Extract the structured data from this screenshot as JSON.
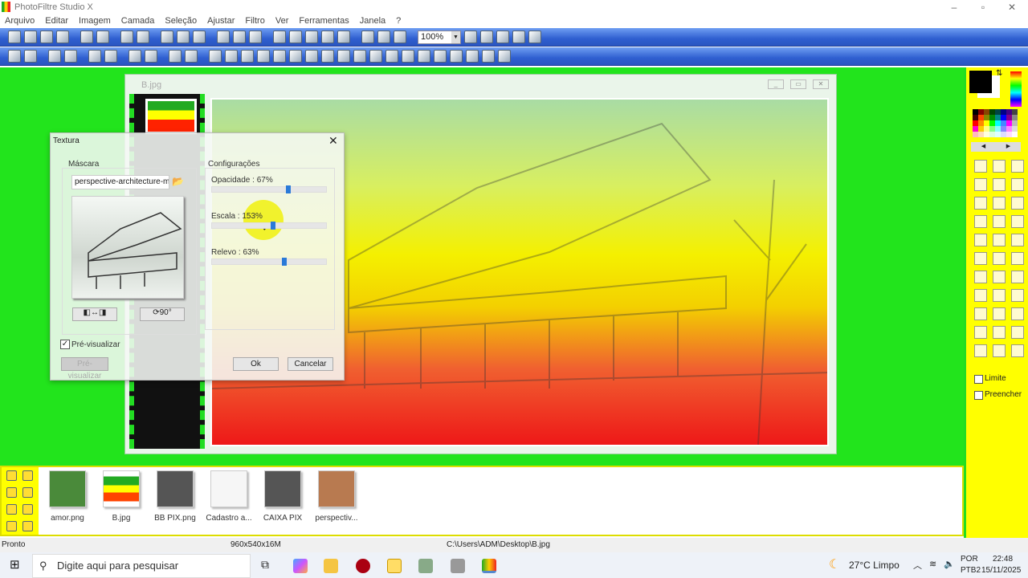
{
  "app": {
    "title": "PhotoFiltre Studio X"
  },
  "menu": [
    "Arquivo",
    "Editar",
    "Imagem",
    "Camada",
    "Seleção",
    "Ajustar",
    "Filtro",
    "Ver",
    "Ferramentas",
    "Janela",
    "?"
  ],
  "toolbar1": {
    "icons": [
      "new-file-icon",
      "open-icon",
      "save-icon",
      "scan-icon",
      "print-icon",
      "print-preview-icon",
      "undo-icon",
      "redo-icon",
      "paste-new-icon",
      "copy-icon",
      "paste-icon",
      "grayscale-icon",
      "rgb-icon",
      "transparency-icon",
      "flip-icon",
      "mirror-icon",
      "crop-icon",
      "text-icon",
      "resize-icon",
      "layer-icon",
      "effect-icon",
      "calendar-icon"
    ],
    "zoom_value": "100%",
    "zoom_icons": [
      "zoom-in-icon",
      "zoom-out-icon",
      "fit-window-icon",
      "actual-size-icon",
      "fullscreen-icon"
    ]
  },
  "toolbar2": {
    "icons": [
      "brightness-minus-icon",
      "brightness-plus-icon",
      "contrast-minus-icon",
      "contrast-plus-icon",
      "gamma-minus-icon",
      "gamma-plus-icon",
      "saturation-minus-icon",
      "saturation-plus-icon",
      "levels-icon",
      "histogram-icon",
      "invert-icon",
      "auto-levels-icon",
      "auto-contrast-icon",
      "film-icon",
      "film2-icon",
      "film3-icon",
      "blur-icon",
      "drop-icon",
      "drop2-icon",
      "mountain-icon",
      "sharpen-icon",
      "sharpen2-icon",
      "color-icon",
      "gradient-icon",
      "texture-icon",
      "columns-icon",
      "rows-icon",
      "layers-icon",
      "layers2-icon"
    ]
  },
  "document": {
    "title": "B.jpg"
  },
  "dialog": {
    "title": "Textura",
    "mask_label": "Máscara",
    "mask_file": "perspective-architecture-m",
    "settings_label": "Configurações",
    "sliders": [
      {
        "label": "Opacidade : 67%",
        "value": 67
      },
      {
        "label": "Escala : 153%",
        "value": 53
      },
      {
        "label": "Relevo : 63%",
        "value": 63
      }
    ],
    "preview_checkbox": "Pré-visualizar",
    "preview_checked": true,
    "preview_button": "Pré-visualizar",
    "ok": "Ok",
    "cancel": "Cancelar"
  },
  "right_panel": {
    "limit": "Limite",
    "fill": "Preencher",
    "tools": [
      "pointer-icon",
      "selection-icon",
      "hand-icon",
      "eyedropper-icon",
      "magic-wand-icon",
      "line-icon",
      "fill-icon",
      "spray-icon",
      "eraser-icon",
      "brush-icon",
      "advanced-brush-icon",
      "stamp-icon",
      "blur-drop-icon",
      "smudge-icon",
      "clone-icon",
      "pattern-icon",
      "portrait-icon",
      "strawberry-icon",
      "rectangle-icon",
      "ellipse-icon",
      "rounded-rect-icon",
      "diamond-icon",
      "triangle-icon",
      "play-shape-icon",
      "lasso-icon",
      "polygon-icon",
      "open-shape-icon",
      "select-all-icon",
      "ratio-43-icon",
      "ratio-32-icon",
      "vertical-select-icon",
      "crop-handles-icon",
      "window-icon"
    ]
  },
  "thumbnails": [
    {
      "label": "amor.png",
      "color": "#4a8a3a"
    },
    {
      "label": "B.jpg",
      "color": "#ffd800"
    },
    {
      "label": "BB PIX.png",
      "color": "#555"
    },
    {
      "label": "Cadastro a...",
      "color": "#f6f6f6"
    },
    {
      "label": "CAIXA PIX",
      "color": "#555"
    },
    {
      "label": "perspectiv...",
      "color": "#b87a50"
    }
  ],
  "status": {
    "left": "Pronto",
    "size": "960x540x16M",
    "path": "C:\\Users\\ADM\\Desktop\\B.jpg"
  },
  "taskbar": {
    "search_placeholder": "Digite aqui para pesquisar",
    "weather": "27°C  Limpo",
    "lang1": "POR",
    "lang2": "PTB2",
    "time": "22:48",
    "date": "15/11/2025"
  }
}
